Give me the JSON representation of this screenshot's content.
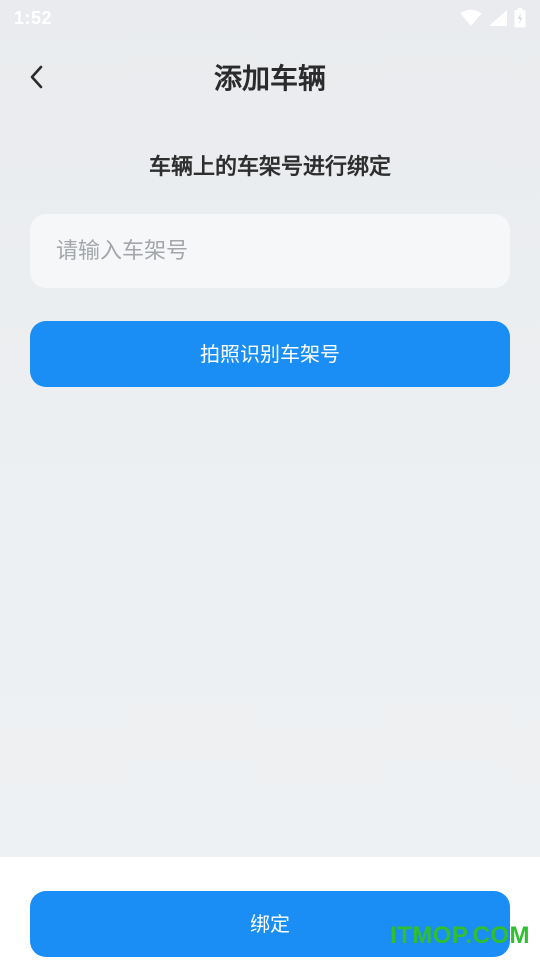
{
  "status_bar": {
    "time": "1:52",
    "icons": [
      "wifi-icon",
      "signal-icon",
      "battery-icon"
    ]
  },
  "nav": {
    "title": "添加车辆",
    "back_icon": "chevron-left-icon"
  },
  "form": {
    "hint": "车辆上的车架号进行绑定",
    "vin_value": "",
    "vin_placeholder": "请输入车架号",
    "photo_button_label": "拍照识别车架号"
  },
  "footer": {
    "bind_button_label": "绑定"
  },
  "watermark": {
    "text": "ITMOP.COM"
  },
  "colors": {
    "accent": "#1a8ef5",
    "background": "#eceef1",
    "input_background": "#f6f7f9",
    "watermark": "#2fbf2f"
  }
}
